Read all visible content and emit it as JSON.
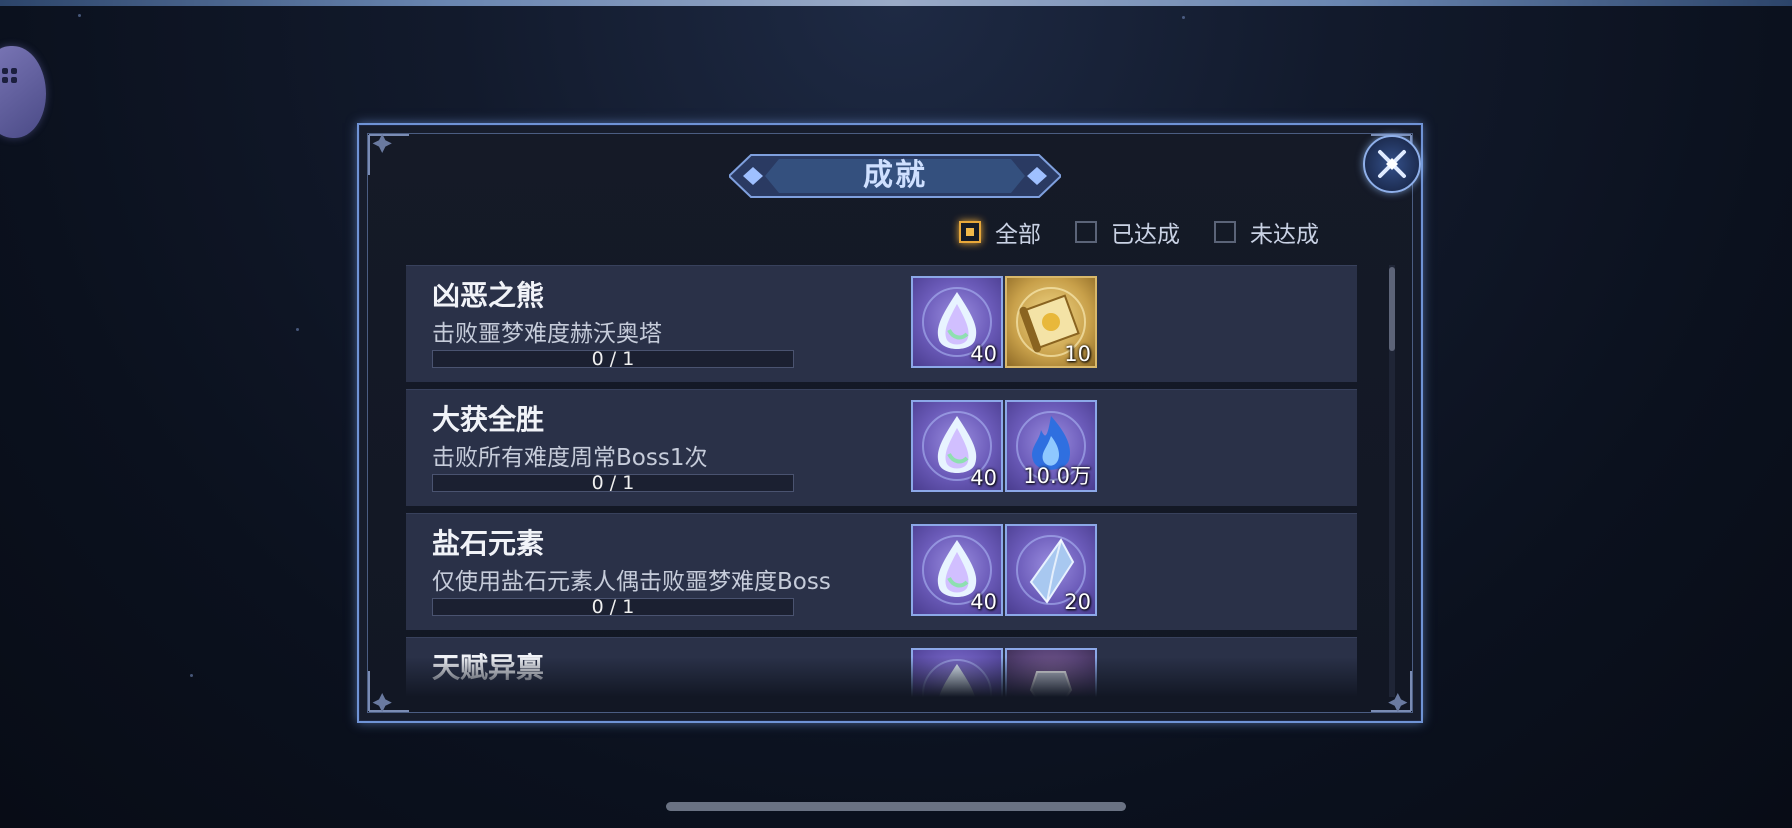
{
  "panel": {
    "title": "成就",
    "close_icon": "close-icon"
  },
  "filters": [
    {
      "label": "全部",
      "checked": true
    },
    {
      "label": "已达成",
      "checked": false
    },
    {
      "label": "未达成",
      "checked": false
    }
  ],
  "achievements": [
    {
      "title": "凶恶之熊",
      "desc": "击败噩梦难度赫沃奥塔",
      "progress_text": "0 / 1",
      "progress": 0,
      "rewards": [
        {
          "icon": "rainbow-gem-icon",
          "qty": "40"
        },
        {
          "icon": "golden-scroll-icon",
          "qty": "10"
        }
      ]
    },
    {
      "title": "大获全胜",
      "desc": "击败所有难度周常Boss1次",
      "progress_text": "0 / 1",
      "progress": 0,
      "rewards": [
        {
          "icon": "rainbow-gem-icon",
          "qty": "40"
        },
        {
          "icon": "blue-flame-icon",
          "qty": "10.0万"
        }
      ]
    },
    {
      "title": "盐石元素",
      "desc": "仅使用盐石元素人偶击败噩梦难度Boss",
      "progress_text": "0 / 1",
      "progress": 0,
      "rewards": [
        {
          "icon": "rainbow-gem-icon",
          "qty": "40"
        },
        {
          "icon": "blue-crystal-icon",
          "qty": "20"
        }
      ]
    },
    {
      "title": "天赋异禀",
      "rewards": [
        {
          "icon": "rainbow-gem-icon"
        },
        {
          "icon": "armor-icon"
        }
      ]
    }
  ]
}
